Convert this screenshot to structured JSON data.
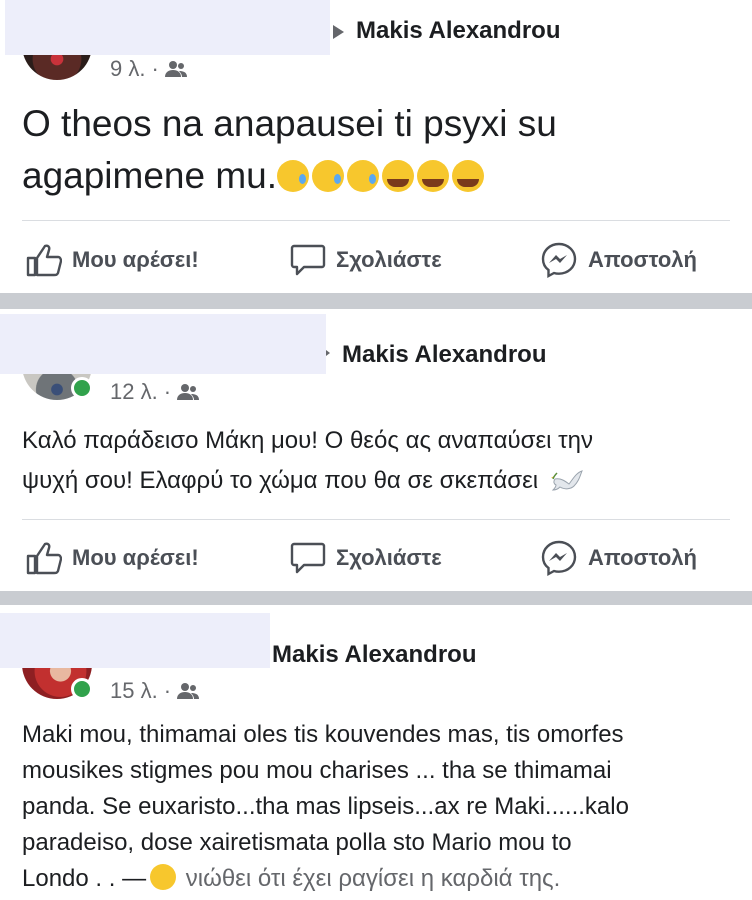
{
  "posts": [
    {
      "author": "Makis Alexandrou",
      "time": "9 λ.",
      "separator": "·",
      "text_line1": "O theos na anapausei ti psyxi su",
      "text_line2": "agapimene mu.",
      "emojis": [
        "sleepy-tear-icon",
        "sleepy-tear-icon",
        "sleepy-tear-icon",
        "loudly-crying-icon",
        "loudly-crying-icon",
        "loudly-crying-icon"
      ]
    },
    {
      "author": "Makis Alexandrou",
      "time": "12 λ.",
      "separator": "·",
      "text_line1": "Καλό παράδεισο Μάκη μου! Ο θεός ας αναπαύσει την",
      "text_line2": "ψυχή σου! Ελαφρύ το χώμα που θα σε σκεπάσει",
      "emoji": "dove-icon"
    },
    {
      "author": "Makis Alexandrou",
      "time": "15 λ.",
      "separator": "·",
      "lines": [
        "Maki mou, thimamai oles tis kouvendes mas, tis omorfes",
        "mousikes stigmes pou mou charises ... tha se thimamai",
        "panda. Se euxaristo...tha mas lipseis...ax re Maki......kalo",
        "paradeiso, dose xairetismata polla sto Mario mou to"
      ],
      "last_line_start": "Londo . . —",
      "feeling": "νιώθει ότι έχει ραγίσει η καρδιά της."
    }
  ],
  "actions": {
    "like": "Μου αρέσει!",
    "comment": "Σχολιάστε",
    "send": "Αποστολή"
  },
  "colors": {
    "separator_bar": "#c9ccd1",
    "online": "#31a24c",
    "meta_text": "#65676b",
    "redaction": "#edeefa"
  }
}
